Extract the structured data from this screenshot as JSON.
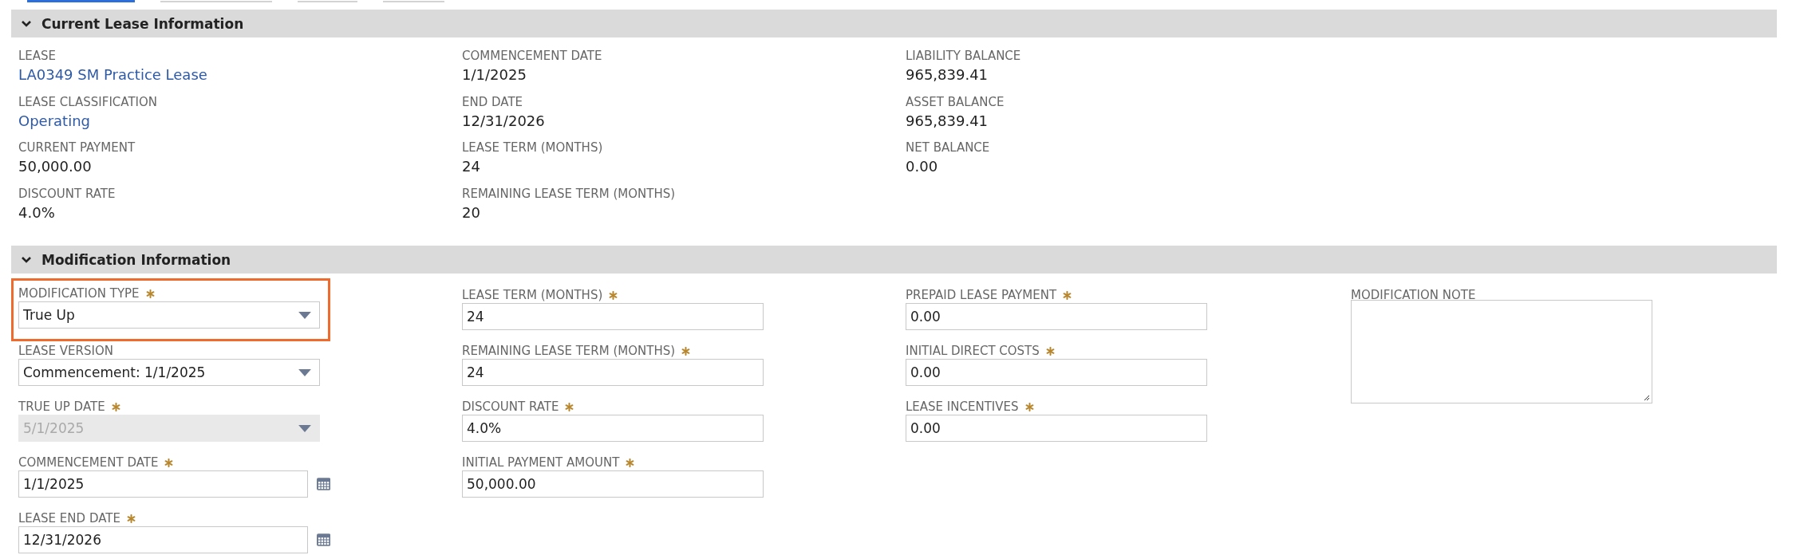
{
  "toolbar": {
    "buttons": [
      {
        "selected": true
      },
      {
        "selected": false
      },
      {
        "selected": false
      },
      {
        "selected": false
      }
    ]
  },
  "current_lease_information": {
    "title": "Current Lease Information",
    "expanded": true,
    "columns": [
      [
        {
          "label": "LEASE",
          "value": "LA0349 SM Practice Lease",
          "kind": "link"
        },
        {
          "label": "LEASE CLASSIFICATION",
          "value": "Operating",
          "kind": "link"
        },
        {
          "label": "CURRENT PAYMENT",
          "value": "50,000.00",
          "kind": "text"
        },
        {
          "label": "DISCOUNT RATE",
          "value": "4.0%",
          "kind": "text"
        }
      ],
      [
        {
          "label": "COMMENCEMENT DATE",
          "value": "1/1/2025",
          "kind": "text"
        },
        {
          "label": "END DATE",
          "value": "12/31/2026",
          "kind": "text"
        },
        {
          "label": "LEASE TERM (MONTHS)",
          "value": "24",
          "kind": "text"
        },
        {
          "label": "REMAINING LEASE TERM (MONTHS)",
          "value": "20",
          "kind": "text"
        }
      ],
      [
        {
          "label": "LIABILITY BALANCE",
          "value": "965,839.41",
          "kind": "text"
        },
        {
          "label": "ASSET BALANCE",
          "value": "965,839.41",
          "kind": "text"
        },
        {
          "label": "NET BALANCE",
          "value": "0.00",
          "kind": "text"
        }
      ]
    ]
  },
  "modification_information": {
    "title": "Modification Information",
    "expanded": true,
    "columns": [
      [
        {
          "label": "MODIFICATION TYPE",
          "value": "True Up",
          "kind": "select",
          "required": true,
          "disabled": false,
          "focused": true
        },
        {
          "label": "LEASE VERSION",
          "value": "Commencement: 1/1/2025",
          "kind": "select",
          "required": false,
          "disabled": false,
          "focused": false
        },
        {
          "label": "TRUE UP DATE",
          "value": "5/1/2025",
          "kind": "select",
          "required": true,
          "disabled": true,
          "focused": false
        },
        {
          "label": "COMMENCEMENT DATE",
          "value": "1/1/2025",
          "kind": "date",
          "required": true,
          "disabled": false,
          "focused": false
        },
        {
          "label": "LEASE END DATE",
          "value": "12/31/2026",
          "kind": "date",
          "required": true,
          "disabled": false,
          "focused": false
        }
      ],
      [
        {
          "label": "LEASE TERM (MONTHS)",
          "value": "24",
          "kind": "text",
          "required": true,
          "disabled": false,
          "focused": false
        },
        {
          "label": "REMAINING LEASE TERM (MONTHS)",
          "value": "24",
          "kind": "text",
          "required": true,
          "disabled": false,
          "focused": false
        },
        {
          "label": "DISCOUNT RATE",
          "value": "4.0%",
          "kind": "text",
          "required": true,
          "disabled": false,
          "focused": false
        },
        {
          "label": "INITIAL PAYMENT AMOUNT",
          "value": "50,000.00",
          "kind": "text",
          "required": true,
          "disabled": false,
          "focused": false
        }
      ],
      [
        {
          "label": "PREPAID LEASE PAYMENT",
          "value": "0.00",
          "kind": "text",
          "required": true,
          "disabled": false,
          "focused": false
        },
        {
          "label": "INITIAL DIRECT COSTS",
          "value": "0.00",
          "kind": "text",
          "required": true,
          "disabled": false,
          "focused": false
        },
        {
          "label": "LEASE INCENTIVES",
          "value": "0.00",
          "kind": "text",
          "required": true,
          "disabled": false,
          "focused": false
        }
      ],
      [
        {
          "label": "MODIFICATION NOTE",
          "kind": "textarea",
          "required": false,
          "disabled": false,
          "focused": false
        }
      ]
    ]
  }
}
